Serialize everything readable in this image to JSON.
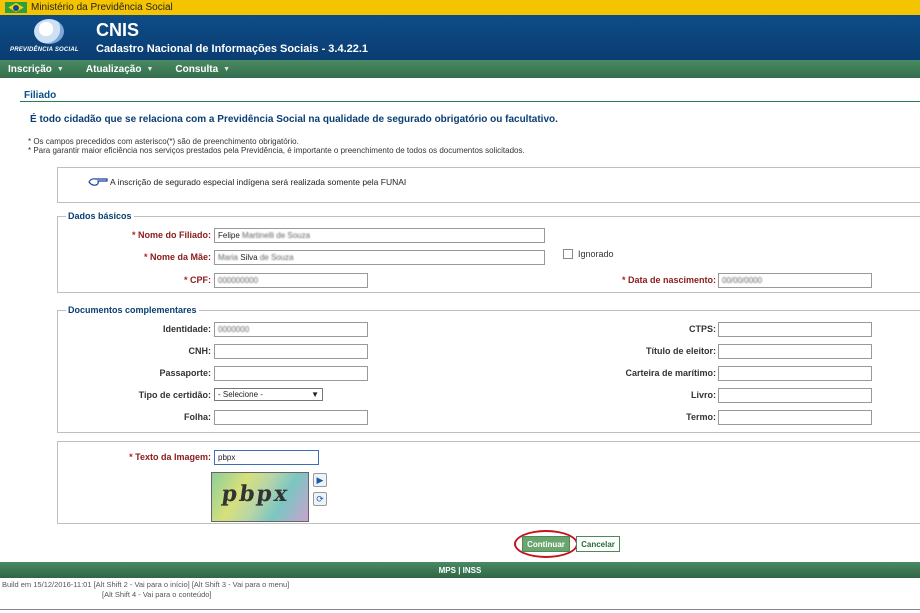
{
  "gov_bar": {
    "title": "Ministério da Previdência Social"
  },
  "header": {
    "logo_text": "PREVIDÊNCIA SOCIAL",
    "app_name": "CNIS",
    "app_subtitle": "Cadastro Nacional de Informações Sociais - 3.4.22.1"
  },
  "nav": {
    "items": [
      {
        "label": "Inscrição"
      },
      {
        "label": "Atualização"
      },
      {
        "label": "Consulta"
      }
    ]
  },
  "page": {
    "title": "Filiado",
    "intro": "É todo cidadão que se relaciona com a Previdência Social na qualidade de segurado obrigatório ou facultativo.",
    "note1": "* Os campos precedidos com asterisco(*) são de preenchimento obrigatório.",
    "note2": "* Para garantir maior eficiência nos serviços prestados pela Previdência, é importante o preenchimento de todos os documentos solicitados.",
    "info_message": "A inscrição de segurado especial indígena será realizada somente pela FUNAI"
  },
  "dados_basicos": {
    "legend": "Dados básicos",
    "nome_filiado_label": "Nome do Filiado:",
    "nome_filiado_value_visible": "Felipe",
    "nome_filiado_value_blurred": "Martinelli de Souza",
    "nome_mae_label": "Nome da Mãe:",
    "nome_mae_value_blurred1": "Maria",
    "nome_mae_value_visible": "Silva",
    "nome_mae_value_blurred2": "de Souza",
    "ignorado_label": "Ignorado",
    "cpf_label": "CPF:",
    "cpf_value_blurred": "000000000",
    "data_nascimento_label": "Data de nascimento:",
    "data_nascimento_value_blurred": "00/00/0000"
  },
  "documentos": {
    "legend": "Documentos complementares",
    "identidade_label": "Identidade:",
    "identidade_value_blurred": "0000000",
    "ctps_label": "CTPS:",
    "cnh_label": "CNH:",
    "titulo_eleitor_label": "Título de eleitor:",
    "passaporte_label": "Passaporte:",
    "carteira_maritimo_label": "Carteira de marítimo:",
    "tipo_certidao_label": "Tipo de certidão:",
    "tipo_certidao_selected": "- Selecione -",
    "livro_label": "Livro:",
    "folha_label": "Folha:",
    "termo_label": "Termo:"
  },
  "captcha": {
    "label": "Texto da Imagem:",
    "value": "pbpx",
    "image_text": "pbpx"
  },
  "actions": {
    "continuar": "Continuar",
    "cancelar": "Cancelar"
  },
  "footer": {
    "links": "MPS | INSS",
    "build_line1": "Build em 15/12/2016-11:01 [Alt Shift 2 - Vai para o início]    [Alt Shift 3 - Vai para o menu]",
    "build_line2": "[Alt Shift 4 - Vai para o conteúdo]"
  },
  "colors": {
    "gov_yellow": "#f5c400",
    "header_blue": "#0e4c86",
    "nav_green": "#336e4c",
    "required_red": "#b21e1e",
    "highlight_red": "#c0151b"
  }
}
